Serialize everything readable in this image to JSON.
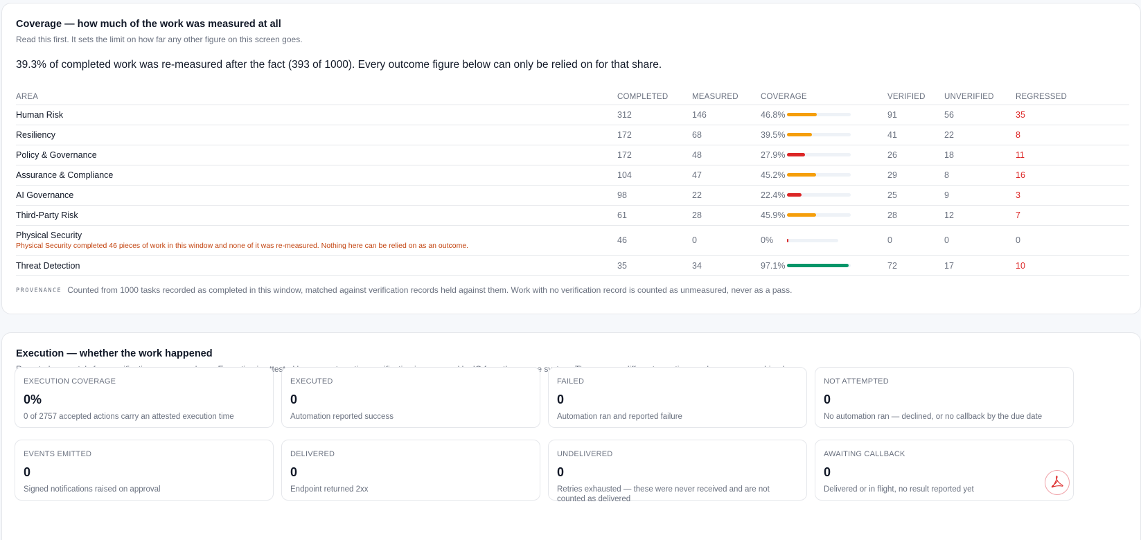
{
  "coverage": {
    "title": "Coverage — how much of the work was measured at all",
    "subtitle": "Read this first. It sets the limit on how far any other figure on this screen goes.",
    "headline": "39.3% of completed work was re-measured after the fact (393 of 1000). Every outcome figure below can only be relied on for that share.",
    "columns": [
      "AREA",
      "COMPLETED",
      "MEASURED",
      "COVERAGE",
      "VERIFIED",
      "UNVERIFIED",
      "REGRESSED"
    ],
    "rows": [
      {
        "area": "Human Risk",
        "completed": "312",
        "measured": "146",
        "coverage": "46.8%",
        "coverage_value": 0.468,
        "bar_color": "#f59e0b",
        "verified": "91",
        "unverified": "56",
        "regressed": "35",
        "note": ""
      },
      {
        "area": "Resiliency",
        "completed": "172",
        "measured": "68",
        "coverage": "39.5%",
        "coverage_value": 0.395,
        "bar_color": "#f59e0b",
        "verified": "41",
        "unverified": "22",
        "regressed": "8",
        "note": ""
      },
      {
        "area": "Policy & Governance",
        "completed": "172",
        "measured": "48",
        "coverage": "27.9%",
        "coverage_value": 0.279,
        "bar_color": "#dc2626",
        "verified": "26",
        "unverified": "18",
        "regressed": "11",
        "note": ""
      },
      {
        "area": "Assurance & Compliance",
        "completed": "104",
        "measured": "47",
        "coverage": "45.2%",
        "coverage_value": 0.452,
        "bar_color": "#f59e0b",
        "verified": "29",
        "unverified": "8",
        "regressed": "16",
        "note": ""
      },
      {
        "area": "AI Governance",
        "completed": "98",
        "measured": "22",
        "coverage": "22.4%",
        "coverage_value": 0.224,
        "bar_color": "#dc2626",
        "verified": "25",
        "unverified": "9",
        "regressed": "3",
        "note": ""
      },
      {
        "area": "Third-Party Risk",
        "completed": "61",
        "measured": "28",
        "coverage": "45.9%",
        "coverage_value": 0.459,
        "bar_color": "#f59e0b",
        "verified": "28",
        "unverified": "12",
        "regressed": "7",
        "note": ""
      },
      {
        "area": "Physical Security",
        "completed": "46",
        "measured": "0",
        "coverage": "0%",
        "coverage_value": 0.0,
        "bar_color": "#dc2626",
        "verified": "0",
        "unverified": "0",
        "regressed": "0",
        "note": "Physical Security completed 46 pieces of work in this window and none of it was re-measured. Nothing here can be relied on as an outcome."
      },
      {
        "area": "Threat Detection",
        "completed": "35",
        "measured": "34",
        "coverage": "97.1%",
        "coverage_value": 0.971,
        "bar_color": "#059669",
        "verified": "72",
        "unverified": "17",
        "regressed": "10",
        "note": ""
      }
    ],
    "provenance_label": "PROVENANCE",
    "provenance_text": "Counted from 1000 tasks recorded as completed in this window, matched against verification records held against them. Work with no verification record is counted as unmeasured, never as a pass."
  },
  "execution": {
    "title": "Execution — whether the work happened",
    "subtitle": "Reported separately from verification coverage above. Execution is attested by your automation; verification is measured by IO from the source system. They answer different questions and are never combined.",
    "cards": [
      {
        "label": "EXECUTION COVERAGE",
        "value": "0%",
        "desc": "0 of 2757 accepted actions carry an attested execution time"
      },
      {
        "label": "EXECUTED",
        "value": "0",
        "desc": "Automation reported success"
      },
      {
        "label": "FAILED",
        "value": "0",
        "desc": "Automation ran and reported failure"
      },
      {
        "label": "NOT ATTEMPTED",
        "value": "0",
        "desc": "No automation ran — declined, or no callback by the due date"
      },
      {
        "label": "EVENTS EMITTED",
        "value": "0",
        "desc": "Signed notifications raised on approval"
      },
      {
        "label": "DELIVERED",
        "value": "0",
        "desc": "Endpoint returned 2xx"
      },
      {
        "label": "UNDELIVERED",
        "value": "0",
        "desc": "Retries exhausted — these were never received and are not counted as delivered"
      },
      {
        "label": "AWAITING CALLBACK",
        "value": "0",
        "desc": "Delivered or in flight, no result reported yet"
      }
    ]
  },
  "fab": {
    "icon": "pdf-export-icon",
    "color": "#dc2626"
  }
}
